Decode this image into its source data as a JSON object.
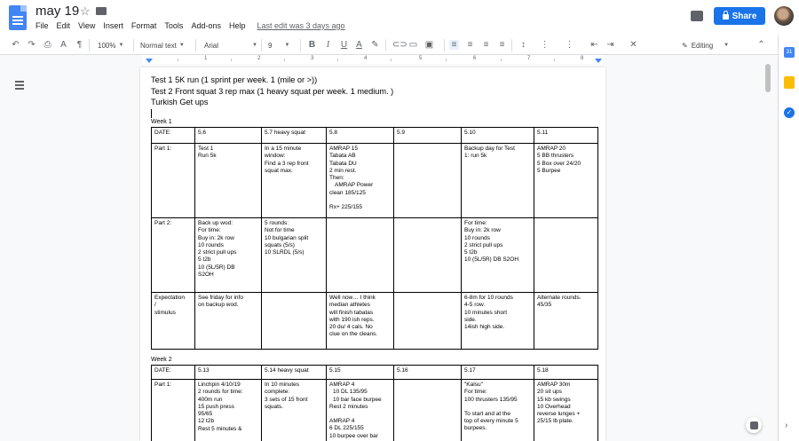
{
  "doc": {
    "title": "may 19",
    "menu": [
      "File",
      "Edit",
      "View",
      "Insert",
      "Format",
      "Tools",
      "Add-ons",
      "Help"
    ],
    "last_edit": "Last edit was 3 days ago",
    "share_label": "Share"
  },
  "toolbar": {
    "zoom": "100%",
    "style": "Normal text",
    "font": "Arial",
    "size": "9",
    "editing": "Editing"
  },
  "ruler": [
    "1",
    "2",
    "3",
    "4",
    "5",
    "6",
    "7",
    "8"
  ],
  "intro": [
    "Test 1 5K run (1 sprint per week. 1 (mile or >))",
    "Test 2 Front squat 3 rep max (1 heavy squat per week. 1 medium. )",
    "Turkish Get ups"
  ],
  "week1": {
    "label": "Week 1",
    "rows": [
      [
        [
          "DATE:"
        ],
        [
          "5.6"
        ],
        [
          "5.7 heavy squat"
        ],
        [
          "5.8"
        ],
        [
          "5.9"
        ],
        [
          "5.10"
        ],
        [
          "5.11"
        ]
      ],
      [
        [
          "Part 1:"
        ],
        [
          "Test 1",
          "Run 5k"
        ],
        [
          "In a 15 minute",
          "window:",
          "Find a 3 rep front",
          "squat max."
        ],
        [
          "AMRAP 15",
          "Tabata AB",
          "Tabata DU",
          "2 min rest.",
          "Then:",
          "AMRAP Power",
          "clean 185/125",
          "",
          "Rx+ 225/155"
        ],
        [
          ""
        ],
        [
          "Backup day for Test",
          "1: run 5k"
        ],
        [
          "AMRAP 20",
          "5 BB thrusters",
          "5 Box over 24/20",
          "5 Burpee"
        ]
      ],
      [
        [
          "Part 2:"
        ],
        [
          "Back up wod:",
          "For time:",
          "Buy in: 2k row",
          "10 rounds",
          "2 strict pull ups",
          "5 t2b",
          "10 (5L/5R) DB",
          "S2OH"
        ],
        [
          "5 rounds:",
          "Not for time",
          "10 bulgarian split",
          "squats (5/s)",
          "10 SLRDL (5/s)"
        ],
        [
          ""
        ],
        [
          ""
        ],
        [
          "For time:",
          "Buy in: 2k row",
          "10 rounds",
          "2 strict pull ups",
          "5 t2b",
          "10 (5L/5R) DB S2OH"
        ],
        [
          ""
        ]
      ],
      [
        [
          "Expectation",
          "/",
          "stimulus"
        ],
        [
          "See friday for info",
          "on backup wod."
        ],
        [
          ""
        ],
        [
          "Well now… I think",
          "median athletes",
          "will finish tabatas",
          "with 190 ish reps.",
          "20 du/ 4 cals. No",
          "clue on the cleans."
        ],
        [
          ""
        ],
        [
          "6-8m for 10 rounds",
          "4-5 row.",
          "10 minutes short",
          "side.",
          "14ish high side."
        ],
        [
          "Alternate rounds.",
          "45/35"
        ]
      ]
    ]
  },
  "week2": {
    "label": "Week 2",
    "rows": [
      [
        [
          "DATE:"
        ],
        [
          "5.13"
        ],
        [
          "5.14 heavy squat"
        ],
        [
          "5.15"
        ],
        [
          "5.16"
        ],
        [
          "5.17"
        ],
        [
          "5.18"
        ]
      ],
      [
        [
          "Part 1:"
        ],
        [
          "Linchpin 4/10/19",
          "2 rounds for time:",
          "400m run",
          "15 push press",
          "95/65",
          "12 t2b",
          "Rest 5 minutes &"
        ],
        [
          "In 10 minutes",
          "complete:",
          "3 sets of 15 front",
          "squats."
        ],
        [
          "AMRAP 4",
          "10 DL 135/95",
          "10 bar face burpee",
          "Rest 2 minutes",
          "",
          "AMRAP 4",
          "6 DL 225/155",
          "10 burpee over bar"
        ],
        [
          ""
        ],
        [
          "\"Kalsu\"",
          "For time:",
          "100 thrusters 135/95",
          "",
          "To start and at the",
          "top of every minute 5",
          "burpees."
        ],
        [
          "AMRAP 30m",
          "20 sit ups",
          "15 kb swings",
          "10 Overhead",
          "reverse lunges +",
          "25/15 lb plate."
        ]
      ]
    ]
  }
}
